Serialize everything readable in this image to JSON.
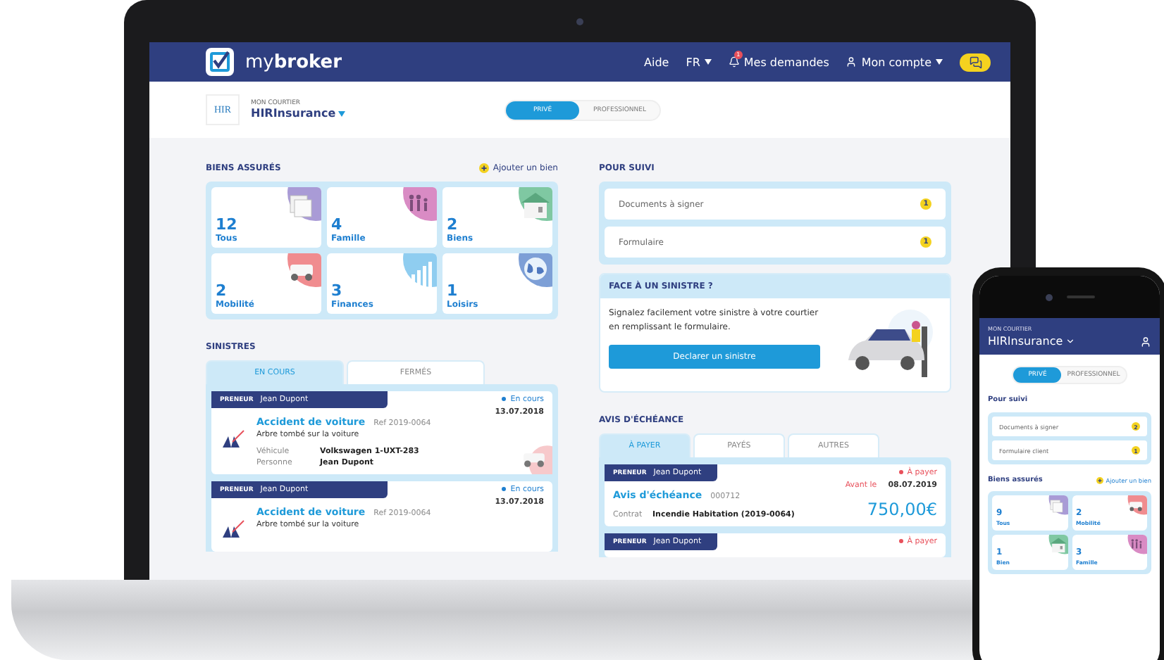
{
  "app": {
    "logo": "my**broker**",
    "nav": [
      {
        "label": "Aide",
        "kind": "link"
      },
      {
        "label": "FR",
        "kind": "dropdown"
      },
      {
        "label": "Mes demandes",
        "kind": "bell",
        "badge": "1"
      },
      {
        "label": "Mon compte",
        "kind": "account"
      }
    ],
    "broker": {
      "logo": "HIR",
      "caption": "MON COURTIER",
      "name": "HIRInsurance"
    },
    "segments": [
      {
        "label": "PRIVÉ",
        "selected": true
      },
      {
        "label": "PROFESSIONNEL",
        "selected": false
      }
    ],
    "biens": {
      "title": "BIENS ASSURÉS",
      "add": "Ajouter un bien",
      "tiles": [
        {
          "count": "12",
          "label": "Tous",
          "kind": "papers",
          "color": "#a99bd6"
        },
        {
          "count": "4",
          "label": "Famille",
          "kind": "people",
          "color": "#d98bc4"
        },
        {
          "count": "2",
          "label": "Biens",
          "kind": "house",
          "color": "#7fc8a2"
        },
        {
          "count": "2",
          "label": "Mobilité",
          "kind": "car",
          "color": "#f08c8f"
        },
        {
          "count": "3",
          "label": "Finances",
          "kind": "chart",
          "color": "#8fcdf0"
        },
        {
          "count": "1",
          "label": "Loisirs",
          "kind": "globe",
          "color": "#7d9fd6"
        }
      ]
    },
    "sinistres": {
      "title": "SINISTRES",
      "tabs": [
        {
          "label": "EN COURS",
          "selected": true
        },
        {
          "label": "FERMÉS",
          "selected": false
        }
      ],
      "claims": [
        {
          "role": "PRENEUR",
          "name": "Jean Dupont",
          "status": "En cours",
          "date": "13.07.2018",
          "title": "Accident de voiture",
          "ref": "Ref 2019-0064",
          "desc": "Arbre tombé sur la voiture",
          "fields": [
            {
              "label": "Véhicule",
              "value": "Volkswagen 1-UXT-283"
            },
            {
              "label": "Personne",
              "value": "Jean Dupont"
            }
          ]
        },
        {
          "role": "PRENEUR",
          "name": "Jean Dupont",
          "status": "En cours",
          "date": "13.07.2018",
          "title": "Accident de voiture",
          "ref": "Ref 2019-0064",
          "desc": "Arbre tombé sur la voiture"
        }
      ]
    },
    "suivi": {
      "title": "POUR SUIVI",
      "items": [
        {
          "label": "Documents à signer",
          "count": "1"
        },
        {
          "label": "Formulaire",
          "count": "1"
        }
      ]
    },
    "face": {
      "title": "FACE À UN SINISTRE ?",
      "text": "Signalez facilement votre sinistre à votre courtier en remplissant le formulaire.",
      "button": "Declarer un sinistre"
    },
    "avis": {
      "title": "AVIS D'ÉCHÉANCE",
      "tabs": [
        {
          "label": "À PAYER",
          "selected": true
        },
        {
          "label": "PAYÉS",
          "selected": false
        },
        {
          "label": "AUTRES",
          "selected": false
        }
      ],
      "notices": [
        {
          "role": "PRENEUR",
          "name": "Jean Dupont",
          "status": "À payer",
          "before": "Avant le",
          "date": "08.07.2019",
          "title": "Avis d'échéance",
          "number": "000712",
          "contract_label": "Contrat",
          "contract": "Incendie Habitation (2019-0064)",
          "amount": "750,00€"
        },
        {
          "role": "PRENEUR",
          "name": "Jean Dupont",
          "status": "À payer"
        }
      ]
    }
  },
  "phone": {
    "caption": "MON COURTIER",
    "name": "HIRInsurance",
    "segments": [
      {
        "label": "PRIVÉ",
        "selected": true
      },
      {
        "label": "PROFESSIONNEL",
        "selected": false
      }
    ],
    "suivi": {
      "title": "Pour suivi",
      "items": [
        {
          "label": "Documents à signer",
          "count": "2"
        },
        {
          "label": "Formulaire client",
          "count": "1"
        }
      ]
    },
    "biens": {
      "title": "Biens assurés",
      "add": "Ajouter un bien",
      "tiles": [
        {
          "count": "9",
          "label": "Tous",
          "kind": "papers",
          "color": "#a99bd6"
        },
        {
          "count": "2",
          "label": "Mobilité",
          "kind": "car",
          "color": "#f08c8f"
        },
        {
          "count": "1",
          "label": "Bien",
          "kind": "house",
          "color": "#7fc8a2"
        },
        {
          "count": "3",
          "label": "Famille",
          "kind": "people",
          "color": "#d98bc4"
        }
      ]
    }
  }
}
